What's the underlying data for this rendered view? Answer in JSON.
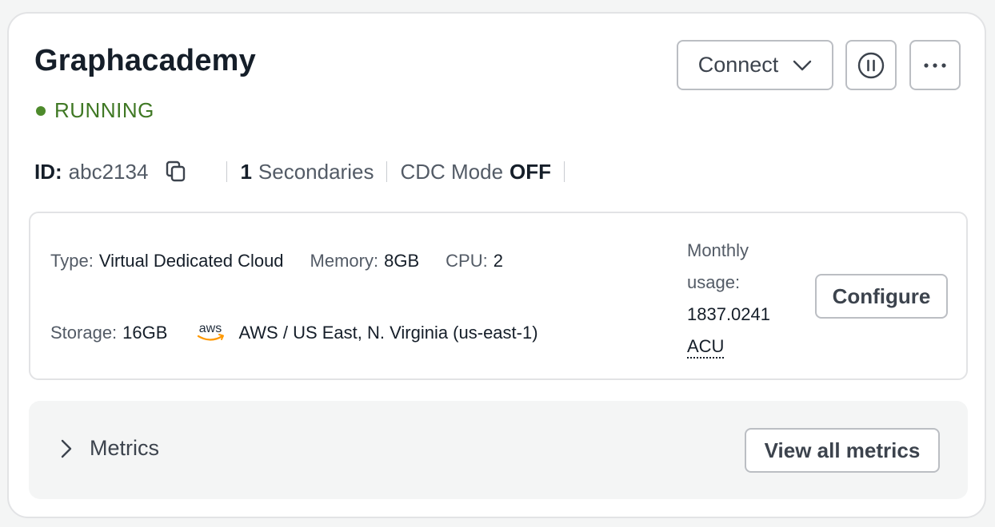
{
  "instance": {
    "name": "Graphacademy",
    "status": "RUNNING",
    "status_color": "#3f7824"
  },
  "actions": {
    "connect_label": "Connect",
    "connect_icon": "chevron-down-icon",
    "pause_icon": "pause-circle-icon",
    "more_icon": "ellipsis-icon"
  },
  "meta": {
    "id_label": "ID:",
    "id_value": "abc2134",
    "copy_icon": "copy-icon",
    "secondaries_count": "1",
    "secondaries_label": "Secondaries",
    "cdc_label": "CDC Mode",
    "cdc_value": "OFF"
  },
  "details": {
    "type_label": "Type:",
    "type_value": "Virtual Dedicated Cloud",
    "memory_label": "Memory:",
    "memory_value": "8GB",
    "cpu_label": "CPU:",
    "cpu_value": "2",
    "storage_label": "Storage:",
    "storage_value": "16GB",
    "provider_logo": "aws-logo",
    "provider_logo_text": "aws",
    "region": "AWS / US East, N. Virginia (us-east-1)",
    "usage_label_1": "Monthly",
    "usage_label_2": "usage:",
    "usage_value": "1837.0241",
    "usage_unit": "ACU",
    "configure_label": "Configure"
  },
  "metrics": {
    "label": "Metrics",
    "toggle_icon": "chevron-right-icon",
    "view_all_label": "View all metrics"
  }
}
